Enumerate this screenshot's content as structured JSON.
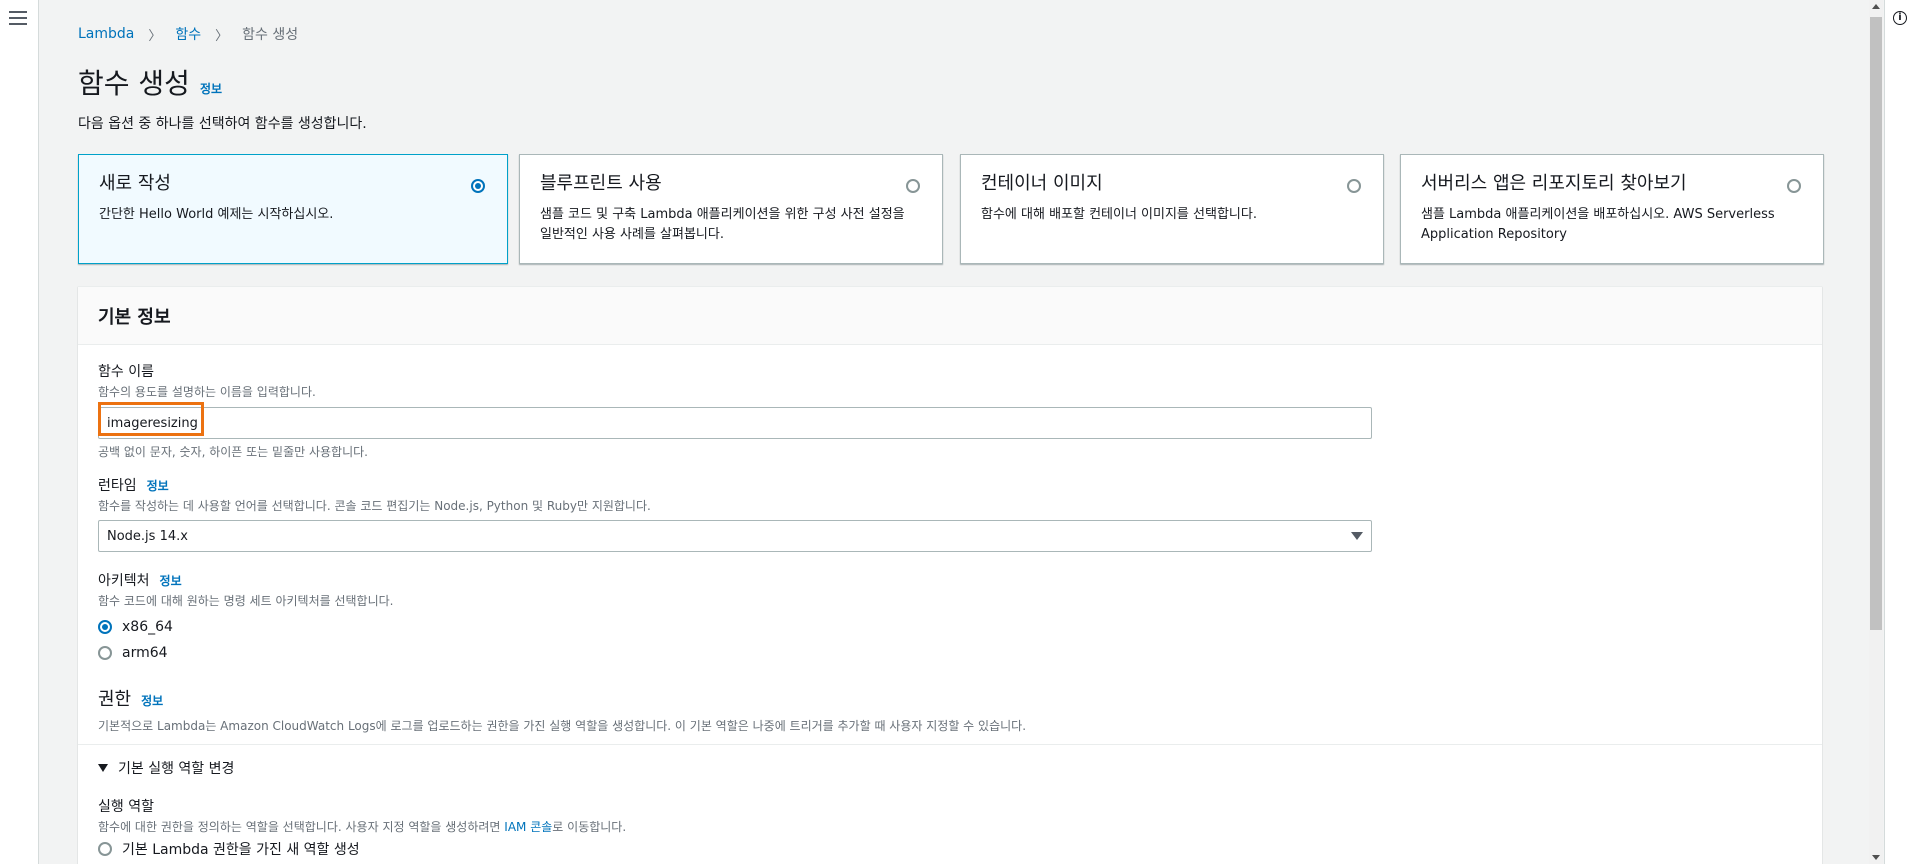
{
  "breadcrumb": {
    "items": [
      "Lambda",
      "함수"
    ],
    "current": "함수 생성"
  },
  "page": {
    "title": "함수 생성",
    "info": "정보",
    "description": "다음 옵션 중 하나를 선택하여 함수를 생성합니다."
  },
  "options": [
    {
      "title": "새로 작성",
      "desc": "간단한 Hello World 예제는 시작하십시오.",
      "selected": true
    },
    {
      "title": "블루프린트 사용",
      "desc": "샘플 코드 및 구축 Lambda 애플리케이션을 위한 구성 사전 설정을 일반적인 사용 사례를 살펴봅니다.",
      "selected": false
    },
    {
      "title": "컨테이너 이미지",
      "desc": "함수에 대해 배포할 컨테이너 이미지를 선택합니다.",
      "selected": false
    },
    {
      "title": "서버리스 앱은 리포지토리 찾아보기",
      "desc": "샘플 Lambda 애플리케이션을 배포하십시오. AWS Serverless Application Repository",
      "selected": false
    }
  ],
  "basic_info": {
    "header": "기본 정보",
    "function_name": {
      "label": "함수 이름",
      "desc": "함수의 용도를 설명하는 이름을 입력합니다.",
      "value": "imageresizing",
      "hint": "공백 없이 문자, 숫자, 하이픈 또는 밑줄만 사용합니다."
    },
    "runtime": {
      "label": "런타임",
      "info": "정보",
      "desc": "함수를 작성하는 데 사용할 언어를 선택합니다. 콘솔 코드 편집기는 Node.js, Python 및 Ruby만 지원합니다.",
      "value": "Node.js 14.x"
    },
    "architecture": {
      "label": "아키텍처",
      "info": "정보",
      "desc": "함수 코드에 대해 원하는 명령 세트 아키텍처를 선택합니다.",
      "options": [
        "x86_64",
        "arm64"
      ],
      "selected": "x86_64"
    },
    "permissions": {
      "title": "권한",
      "info": "정보",
      "desc": "기본적으로 Lambda는 Amazon CloudWatch Logs에 로그를 업로드하는 권한을 가진 실행 역할을 생성합니다. 이 기본 역할은 나중에 트리거를 추가할 때 사용자 지정할 수 있습니다."
    },
    "role_expander": {
      "label": "기본 실행 역할 변경",
      "exec_role_label": "실행 역할",
      "exec_role_desc_prefix": "함수에 대한 권한을 정의하는 역할을 선택합니다. 사용자 지정 역할을 생성하려면 ",
      "exec_role_link": "IAM 콘솔",
      "exec_role_desc_suffix": "로 이동합니다.",
      "option_new_role": "기본 Lambda 권한을 가진 새 역할 생성"
    }
  }
}
